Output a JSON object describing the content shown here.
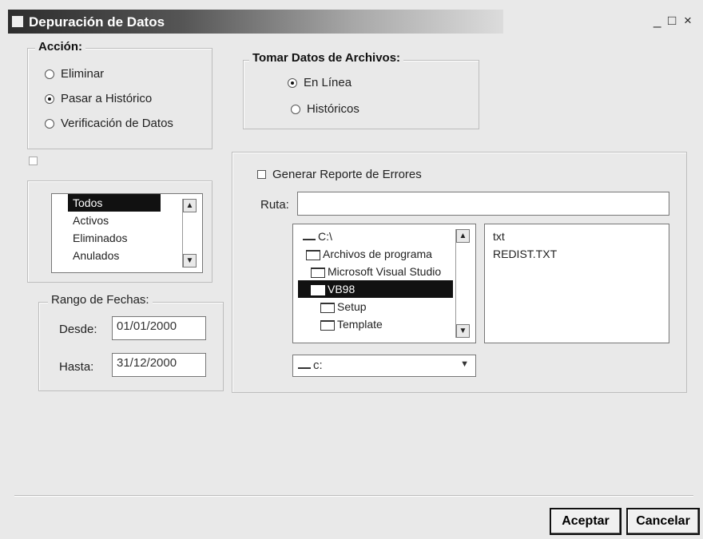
{
  "window": {
    "title": "Depuración de Datos",
    "controls": {
      "minimize": "_",
      "maximize": "□",
      "close": "×"
    }
  },
  "accion": {
    "legend": "Acción:",
    "options": [
      {
        "label": "Eliminar",
        "selected": false
      },
      {
        "label": "Pasar a Histórico",
        "selected": true
      },
      {
        "label": "Verificación de Datos",
        "selected": false
      }
    ]
  },
  "tomar": {
    "legend": "Tomar Datos de Archivos:",
    "options": [
      {
        "label": "En Línea",
        "selected": true
      },
      {
        "label": "Históricos",
        "selected": false
      }
    ]
  },
  "registros": {
    "items": [
      "Todos",
      "Activos",
      "Eliminados",
      "Anulados"
    ],
    "selected": "Todos"
  },
  "rango": {
    "legend": "Rango de Fechas:",
    "desde_label": "Desde:",
    "desde_value": "01/01/2000",
    "hasta_label": "Hasta:",
    "hasta_value": "31/12/2000"
  },
  "errores": {
    "generar_label": "Generar Reporte de Errores",
    "ruta_label": "Ruta:",
    "ruta_value": ""
  },
  "dirlist": {
    "items": [
      {
        "label": "C:\\",
        "type": "drive"
      },
      {
        "label": "Archivos de programa",
        "type": "folder"
      },
      {
        "label": "Microsoft Visual Studio",
        "type": "folder"
      },
      {
        "label": "VB98",
        "type": "folder-open",
        "selected": true
      },
      {
        "label": "Setup",
        "type": "folder"
      },
      {
        "label": "Template",
        "type": "folder"
      }
    ]
  },
  "filelist": {
    "items": [
      "txt",
      "REDIST.TXT"
    ]
  },
  "drive": {
    "value": "c:"
  },
  "buttons": {
    "aceptar": "Aceptar",
    "cancelar": "Cancelar"
  }
}
